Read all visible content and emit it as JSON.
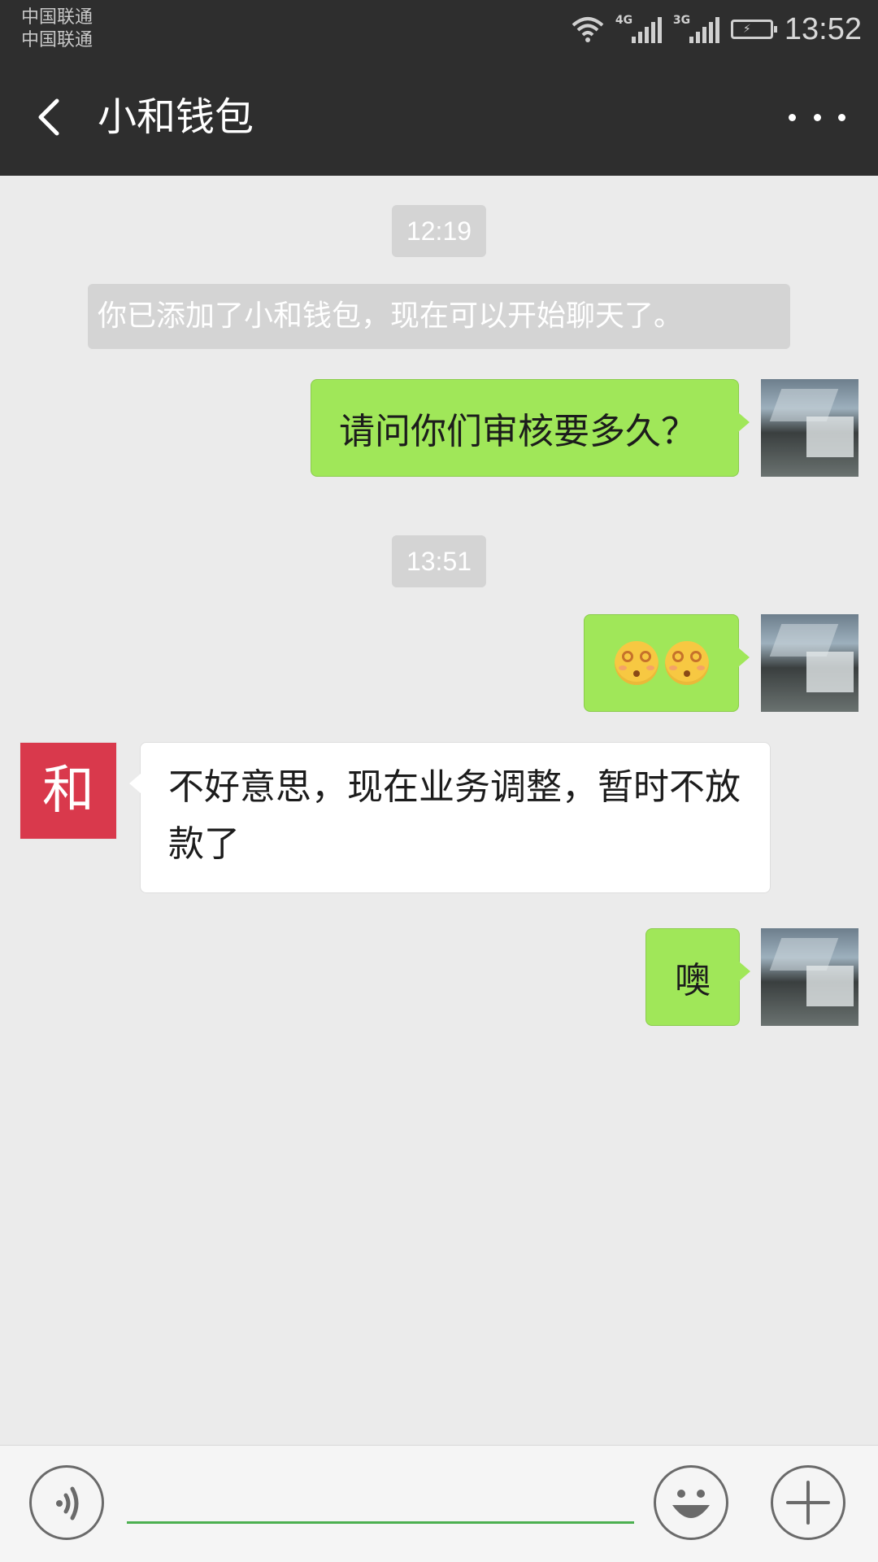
{
  "status_bar": {
    "carrier_1": "中国联通",
    "carrier_2": "中国联通",
    "network_1": "4G",
    "network_2": "3G",
    "time": "13:52",
    "icons": [
      "wifi-icon",
      "signal-4g-icon",
      "signal-3g-icon",
      "battery-charging-icon"
    ]
  },
  "nav": {
    "back_icon": "chevron-left-icon",
    "title": "小和钱包",
    "more_icon": "more-horizontal-icon"
  },
  "chat": {
    "timestamp_1": "12:19",
    "system_message": "你已添加了小和钱包，现在可以开始聊天了。",
    "msg_1": "请问你们审核要多久？",
    "timestamp_2": "13:51",
    "msg_2_emoji": [
      "dizzy-face-emoji",
      "dizzy-face-emoji"
    ],
    "msg_3": "不好意思，现在业务调整，暂时不放款了",
    "contact_avatar_text": "和",
    "msg_4": "噢"
  },
  "input_bar": {
    "voice_icon": "voice-icon",
    "input_value": "",
    "emoji_icon": "smiley-icon",
    "plus_icon": "plus-icon"
  },
  "colors": {
    "header_bg": "#2e2e2e",
    "chat_bg": "#ebebeb",
    "sent_bubble": "#a0e759",
    "received_bubble": "#ffffff",
    "timestamp_pill": "#d4d4d4",
    "contact_avatar": "#d9394c",
    "input_underline": "#4cb050"
  }
}
